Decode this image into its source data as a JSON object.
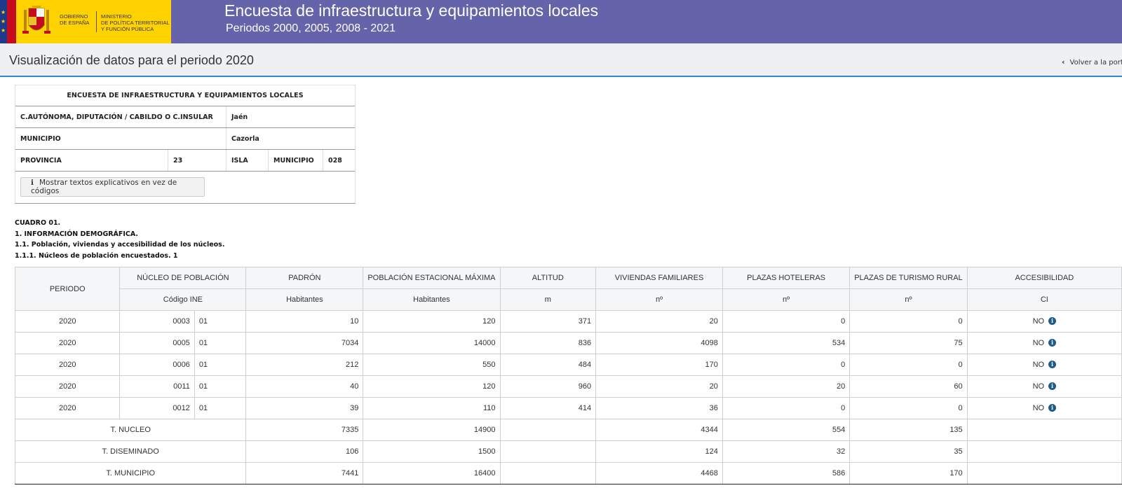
{
  "header": {
    "gov_line1": "GOBIERNO",
    "gov_line2": "DE ESPAÑA",
    "ministry_line1": "MINISTERIO",
    "ministry_line2": "DE POLÍTICA TERRITORIAL",
    "ministry_line3": "Y FUNCIÓN PÚBLICA",
    "title": "Encuesta de infraestructura y equipamientos locales",
    "subtitle": "Periodos 2000, 2005, 2008 - 2021",
    "colors": {
      "banner": "#6563a9",
      "logo_bg": "#ffd200",
      "accent": "#2e8ad0"
    }
  },
  "page": {
    "title": "Visualización de datos para el periodo 2020",
    "back_link": "Volver a la portada"
  },
  "info": {
    "heading": "ENCUESTA DE INFRAESTRUCTURA Y EQUIPAMIENTOS LOCALES",
    "ccaa_label": "C.AUTÓNOMA, DIPUTACIÓN / CABILDO O C.INSULAR",
    "ccaa_value": "Jaén",
    "municipio_label": "MUNICIPIO",
    "municipio_value": "Cazorla",
    "provincia_label": "PROVINCIA",
    "provincia_value": "23",
    "isla_label": "ISLA",
    "muni_code_label": "MUNICIPIO",
    "muni_code_value": "028",
    "toggle_button": "Mostrar textos explicativos en vez de códigos"
  },
  "cuadro": {
    "line1": "CUADRO 01.",
    "line2": "1. INFORMACIÓN DEMOGRÁFICA.",
    "line3": "1.1. Población, viviendas y accesibilidad de los núcleos.",
    "line4": "1.1.1. Núcleos de población encuestados. 1"
  },
  "table": {
    "headers": {
      "periodo": "PERIODO",
      "nucleo": "NÚCLEO DE POBLACIÓN",
      "padron": "PADRÓN",
      "poblacion": "POBLACIÓN ESTACIONAL MÁXIMA",
      "altitud": "ALTITUD",
      "viviendas": "VIVIENDAS FAMILIARES",
      "hoteleras": "PLAZAS HOTELERAS",
      "turismo": "PLAZAS DE TURISMO RURAL",
      "accesibilidad": "ACCESIBILIDAD"
    },
    "subheaders": {
      "nucleo": "Código INE",
      "padron": "Habitantes",
      "poblacion": "Habitantes",
      "altitud": "m",
      "viviendas": "nº",
      "hoteleras": "nº",
      "turismo": "nº",
      "accesibilidad": "CI"
    },
    "rows": [
      {
        "periodo": "2020",
        "code": "0003",
        "sub": "01",
        "padron": "10",
        "poblacion": "120",
        "altitud": "371",
        "viviendas": "20",
        "hoteleras": "0",
        "turismo": "0",
        "acc": "NO"
      },
      {
        "periodo": "2020",
        "code": "0005",
        "sub": "01",
        "padron": "7034",
        "poblacion": "14000",
        "altitud": "836",
        "viviendas": "4098",
        "hoteleras": "534",
        "turismo": "75",
        "acc": "NO"
      },
      {
        "periodo": "2020",
        "code": "0006",
        "sub": "01",
        "padron": "212",
        "poblacion": "550",
        "altitud": "484",
        "viviendas": "170",
        "hoteleras": "0",
        "turismo": "0",
        "acc": "NO"
      },
      {
        "periodo": "2020",
        "code": "0011",
        "sub": "01",
        "padron": "40",
        "poblacion": "120",
        "altitud": "960",
        "viviendas": "20",
        "hoteleras": "20",
        "turismo": "60",
        "acc": "NO"
      },
      {
        "periodo": "2020",
        "code": "0012",
        "sub": "01",
        "padron": "39",
        "poblacion": "110",
        "altitud": "414",
        "viviendas": "36",
        "hoteleras": "0",
        "turismo": "0",
        "acc": "NO"
      }
    ],
    "totals": [
      {
        "label": "T. NUCLEO",
        "padron": "7335",
        "poblacion": "14900",
        "viviendas": "4344",
        "hoteleras": "554",
        "turismo": "135"
      },
      {
        "label": "T. DISEMINADO",
        "padron": "106",
        "poblacion": "1500",
        "viviendas": "124",
        "hoteleras": "32",
        "turismo": "35"
      },
      {
        "label": "T. MUNICIPIO",
        "padron": "7441",
        "poblacion": "16400",
        "viviendas": "4468",
        "hoteleras": "586",
        "turismo": "170"
      }
    ]
  }
}
